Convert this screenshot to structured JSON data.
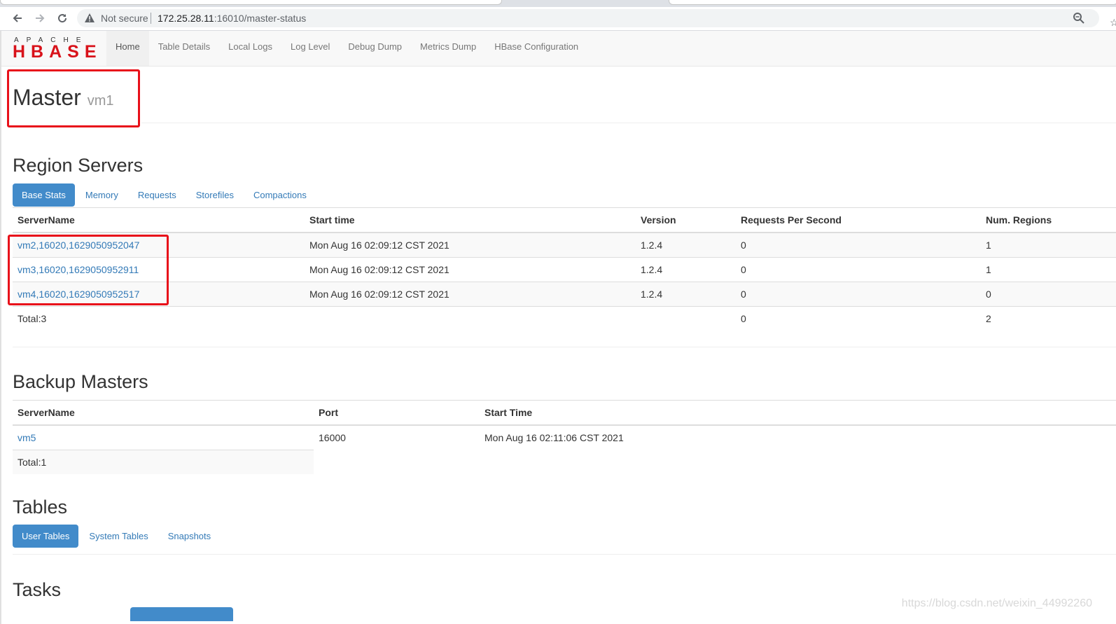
{
  "browser": {
    "security_label": "Not secure",
    "url_host": "172.25.28.11",
    "url_path": ":16010/master-status"
  },
  "navbar": {
    "logo_top": "APACHE",
    "logo_main": "HBASE",
    "links": [
      "Home",
      "Table Details",
      "Local Logs",
      "Log Level",
      "Debug Dump",
      "Metrics Dump",
      "HBase Configuration"
    ]
  },
  "master": {
    "title": "Master",
    "host": "vm1"
  },
  "region_servers": {
    "heading": "Region Servers",
    "tabs": [
      "Base Stats",
      "Memory",
      "Requests",
      "Storefiles",
      "Compactions"
    ],
    "columns": [
      "ServerName",
      "Start time",
      "Version",
      "Requests Per Second",
      "Num. Regions"
    ],
    "rows": [
      [
        "vm2,16020,1629050952047",
        "Mon Aug 16 02:09:12 CST 2021",
        "1.2.4",
        "0",
        "1"
      ],
      [
        "vm3,16020,1629050952911",
        "Mon Aug 16 02:09:12 CST 2021",
        "1.2.4",
        "0",
        "1"
      ],
      [
        "vm4,16020,1629050952517",
        "Mon Aug 16 02:09:12 CST 2021",
        "1.2.4",
        "0",
        "0"
      ]
    ],
    "total": {
      "label": "Total:3",
      "requests": "0",
      "regions": "2"
    }
  },
  "backup_masters": {
    "heading": "Backup Masters",
    "columns": [
      "ServerName",
      "Port",
      "Start Time"
    ],
    "rows": [
      [
        "vm5",
        "16000",
        "Mon Aug 16 02:11:06 CST 2021"
      ]
    ],
    "total": "Total:1"
  },
  "tables": {
    "heading": "Tables",
    "tabs": [
      "User Tables",
      "System Tables",
      "Snapshots"
    ]
  },
  "tasks": {
    "heading": "Tasks"
  },
  "watermark": "https://blog.csdn.net/weixin_44992260",
  "colors": {
    "highlight": "#e8101a",
    "link": "#337ab7",
    "pill_active": "#428bca",
    "logo_red": "#d8121a"
  }
}
